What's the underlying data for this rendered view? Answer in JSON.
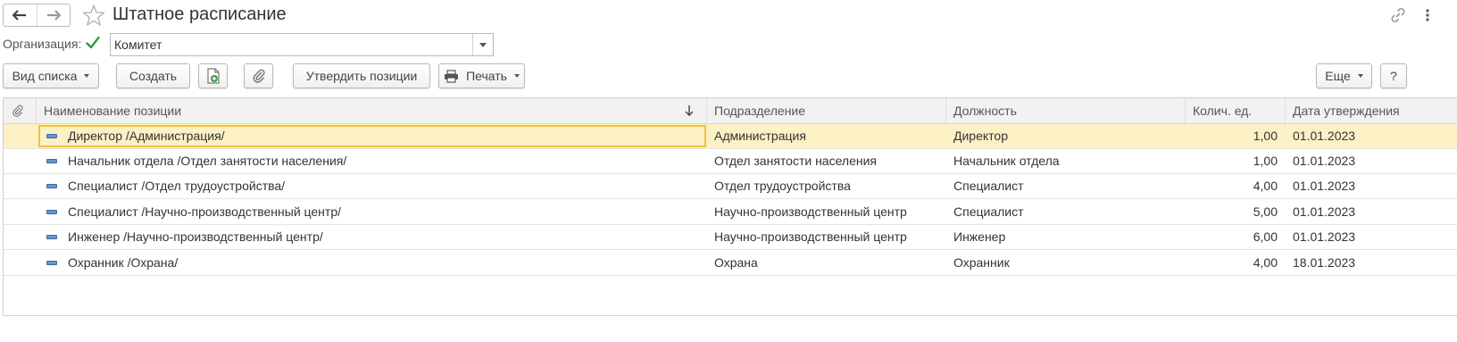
{
  "window": {
    "title": "Штатное расписание",
    "icons": {
      "back": "arrow-left-icon",
      "forward": "arrow-right-icon",
      "favorite": "star-icon",
      "link": "link-icon",
      "more": "more-vertical-icon"
    }
  },
  "filter": {
    "org_label": "Организация:",
    "org_checked": true,
    "org_value": "Комитет"
  },
  "toolbar": {
    "list_view_label": "Вид списка",
    "create_label": "Создать",
    "approve_label": "Утвердить позиции",
    "print_label": "Печать",
    "more_label": "Еще",
    "help_label": "?"
  },
  "table": {
    "columns": [
      "Наименование позиции",
      "Подразделение",
      "Должность",
      "Колич. ед.",
      "Дата утверждения"
    ],
    "rows": [
      {
        "name": "Директор /Администрация/",
        "department": "Администрация",
        "position": "Директор",
        "qty": "1,00",
        "date": "01.01.2023"
      },
      {
        "name": "Начальник отдела /Отдел занятости населения/",
        "department": "Отдел занятости населения",
        "position": "Начальник отдела",
        "qty": "1,00",
        "date": "01.01.2023"
      },
      {
        "name": "Специалист /Отдел трудоустройства/",
        "department": "Отдел трудоустройства",
        "position": "Специалист",
        "qty": "4,00",
        "date": "01.01.2023"
      },
      {
        "name": "Специалист /Научно-производственный центр/",
        "department": "Научно-производственный центр",
        "position": "Специалист",
        "qty": "5,00",
        "date": "01.01.2023"
      },
      {
        "name": "Инженер /Научно-производственный центр/",
        "department": "Научно-производственный центр",
        "position": "Инженер",
        "qty": "6,00",
        "date": "01.01.2023"
      },
      {
        "name": "Охранник /Охрана/",
        "department": "Охрана",
        "position": "Охранник",
        "qty": "4,00",
        "date": "18.01.2023"
      }
    ],
    "selected_row": 0
  },
  "colors": {
    "selected_row": "#fcf1c5",
    "focus_border": "#f2c23a",
    "check_green": "#2e9a3b",
    "row_icon": "#6c93c7"
  }
}
